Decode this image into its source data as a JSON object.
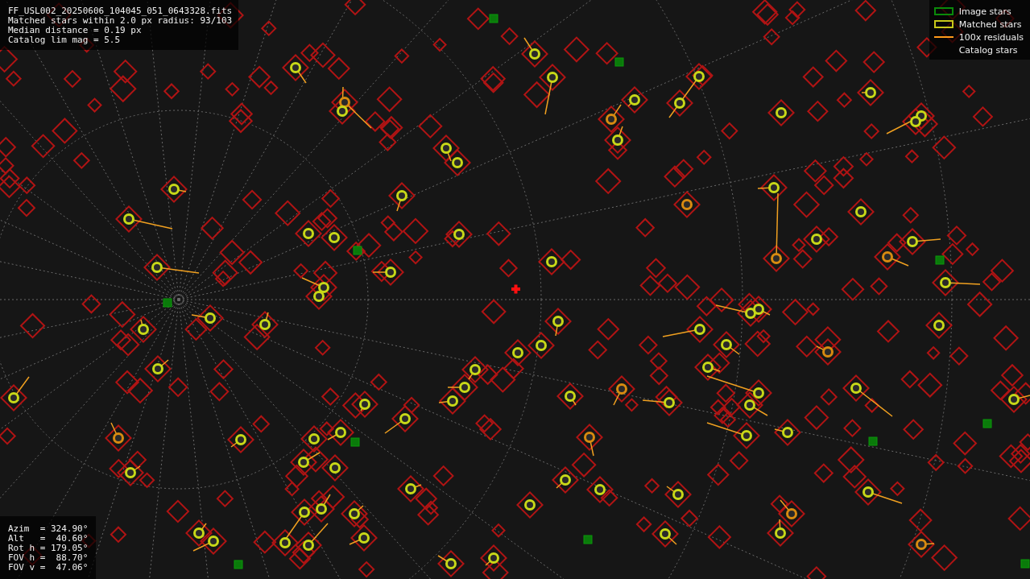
{
  "header_info": [
    "FF_USL002_20250606_104045_051_0643328.fits",
    "Matched stars within 2.0 px radius: 93/103",
    "Median distance = 0.19 px",
    "Catalog lim mag = 5.5"
  ],
  "legend": [
    {
      "kind": "image",
      "label": "Image stars"
    },
    {
      "kind": "matched",
      "label": "Matched stars"
    },
    {
      "kind": "residual",
      "label": "100x residuals"
    },
    {
      "kind": "catalog",
      "label": "Catalog stars"
    }
  ],
  "pointing_info": [
    "Azim  = 324.90°",
    "Alt   =  40.60°",
    "Rot h = 179.05°",
    "FOV h =  88.70°",
    "FOV v =  47.06°"
  ]
}
